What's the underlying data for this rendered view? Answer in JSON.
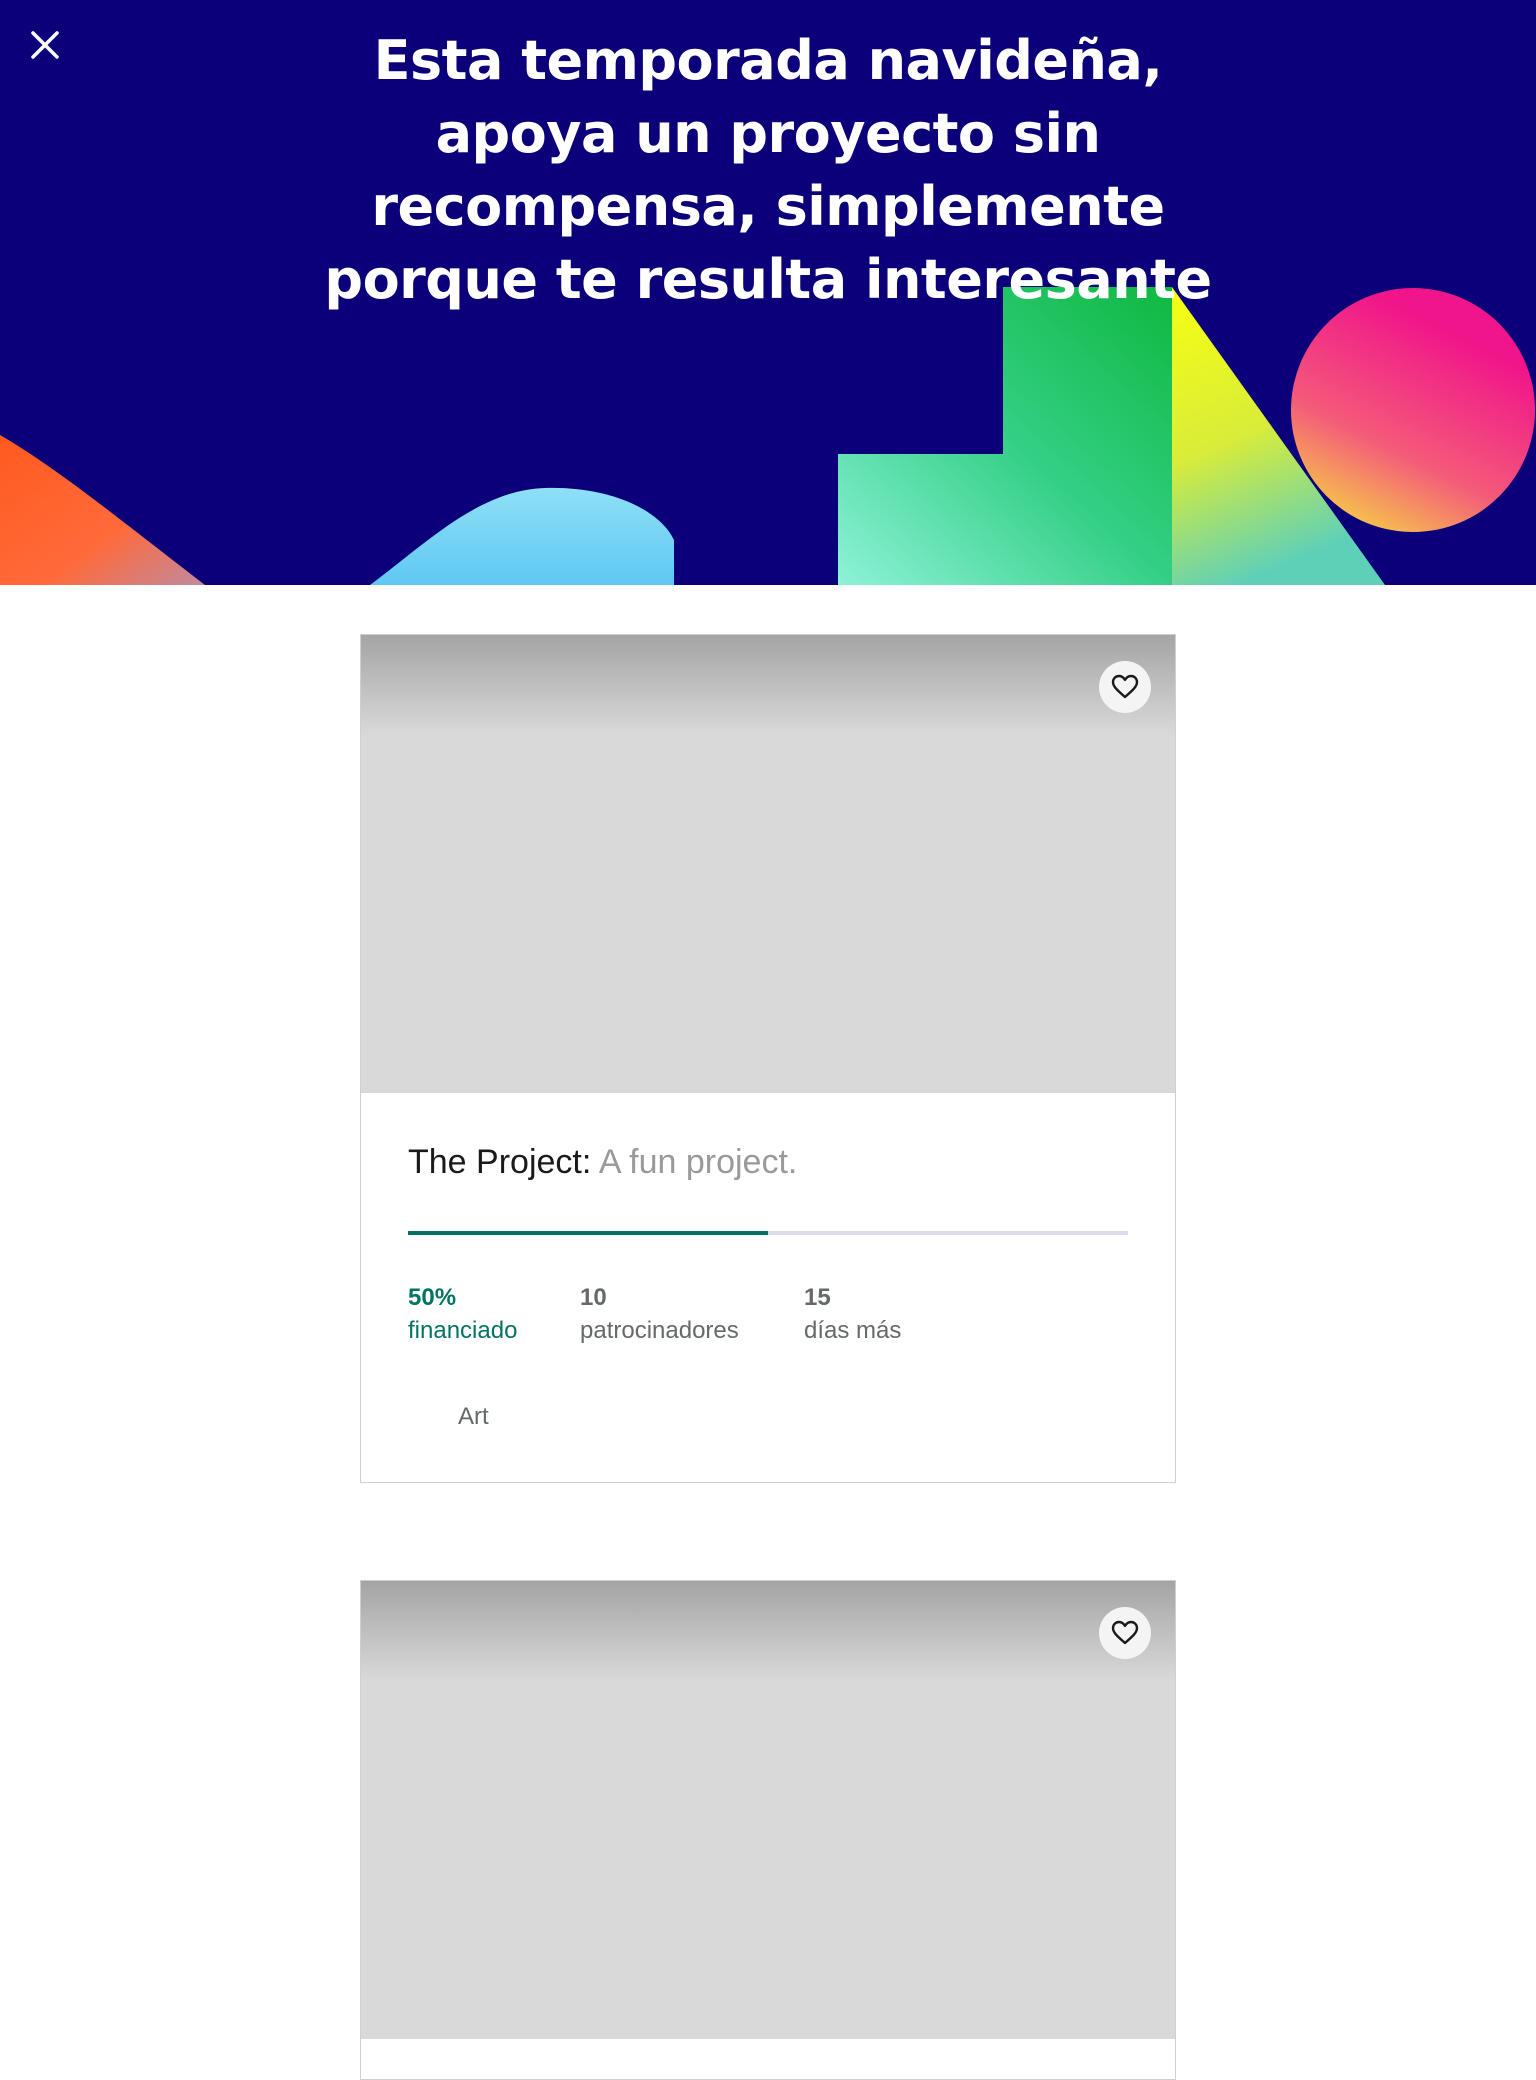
{
  "colors": {
    "hero_background": "#0b0079",
    "funded_accent": "#037362",
    "progress_track": "#dcdcec",
    "muted_text": "#656969",
    "blurb_text": "#9a9a9a"
  },
  "header": {
    "close_icon": "close-icon",
    "title": "Esta temporada navideña, apoya un proyecto sin recompensa, simplemente porque te resulta interesante"
  },
  "projects": [
    {
      "name": "The Project:",
      "blurb": " A fun project.",
      "percent_funded": 50,
      "funded_value": "50%",
      "funded_label": "financiado",
      "backers_value": "10",
      "backers_label": "patrocinadores",
      "days_value": "15",
      "days_label": "días más",
      "category": "Art",
      "favorite_icon": "heart-icon"
    },
    {
      "favorite_icon": "heart-icon"
    }
  ]
}
